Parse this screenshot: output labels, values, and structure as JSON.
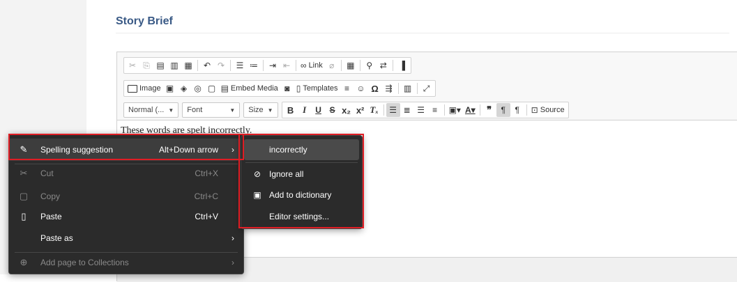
{
  "page": {
    "title": "Story Brief"
  },
  "toolbar": {
    "row1": {
      "link_label": "Link"
    },
    "row2": {
      "image_label": "Image",
      "embed_label": "Embed Media",
      "templates_label": "Templates"
    },
    "row3": {
      "format_value": "Normal (...",
      "font_value": "Font",
      "size_value": "Size",
      "source_label": "Source"
    }
  },
  "editor": {
    "content": "These words are spelt incorrectly."
  },
  "context_menu": {
    "items": [
      {
        "label": "Spelling suggestion",
        "shortcut": "Alt+Down arrow",
        "icon": "spellcheck-pen-icon"
      },
      {
        "label": "Cut",
        "shortcut": "Ctrl+X",
        "icon": "scissors-icon"
      },
      {
        "label": "Copy",
        "shortcut": "Ctrl+C",
        "icon": "copy-icon"
      },
      {
        "label": "Paste",
        "shortcut": "Ctrl+V",
        "icon": "paste-icon"
      },
      {
        "label": "Paste as",
        "icon": ""
      },
      {
        "label": "Add page to Collections",
        "icon": "collections-icon"
      }
    ]
  },
  "submenu": {
    "items": [
      {
        "label": "incorrectly"
      },
      {
        "label": "Ignore all",
        "icon": "ignore-icon"
      },
      {
        "label": "Add to dictionary",
        "icon": "add-dictionary-icon"
      },
      {
        "label": "Editor settings..."
      }
    ]
  },
  "colors": {
    "highlight": "#e01d24",
    "menu_bg": "#2b2b2b",
    "title": "#3a5a86"
  }
}
